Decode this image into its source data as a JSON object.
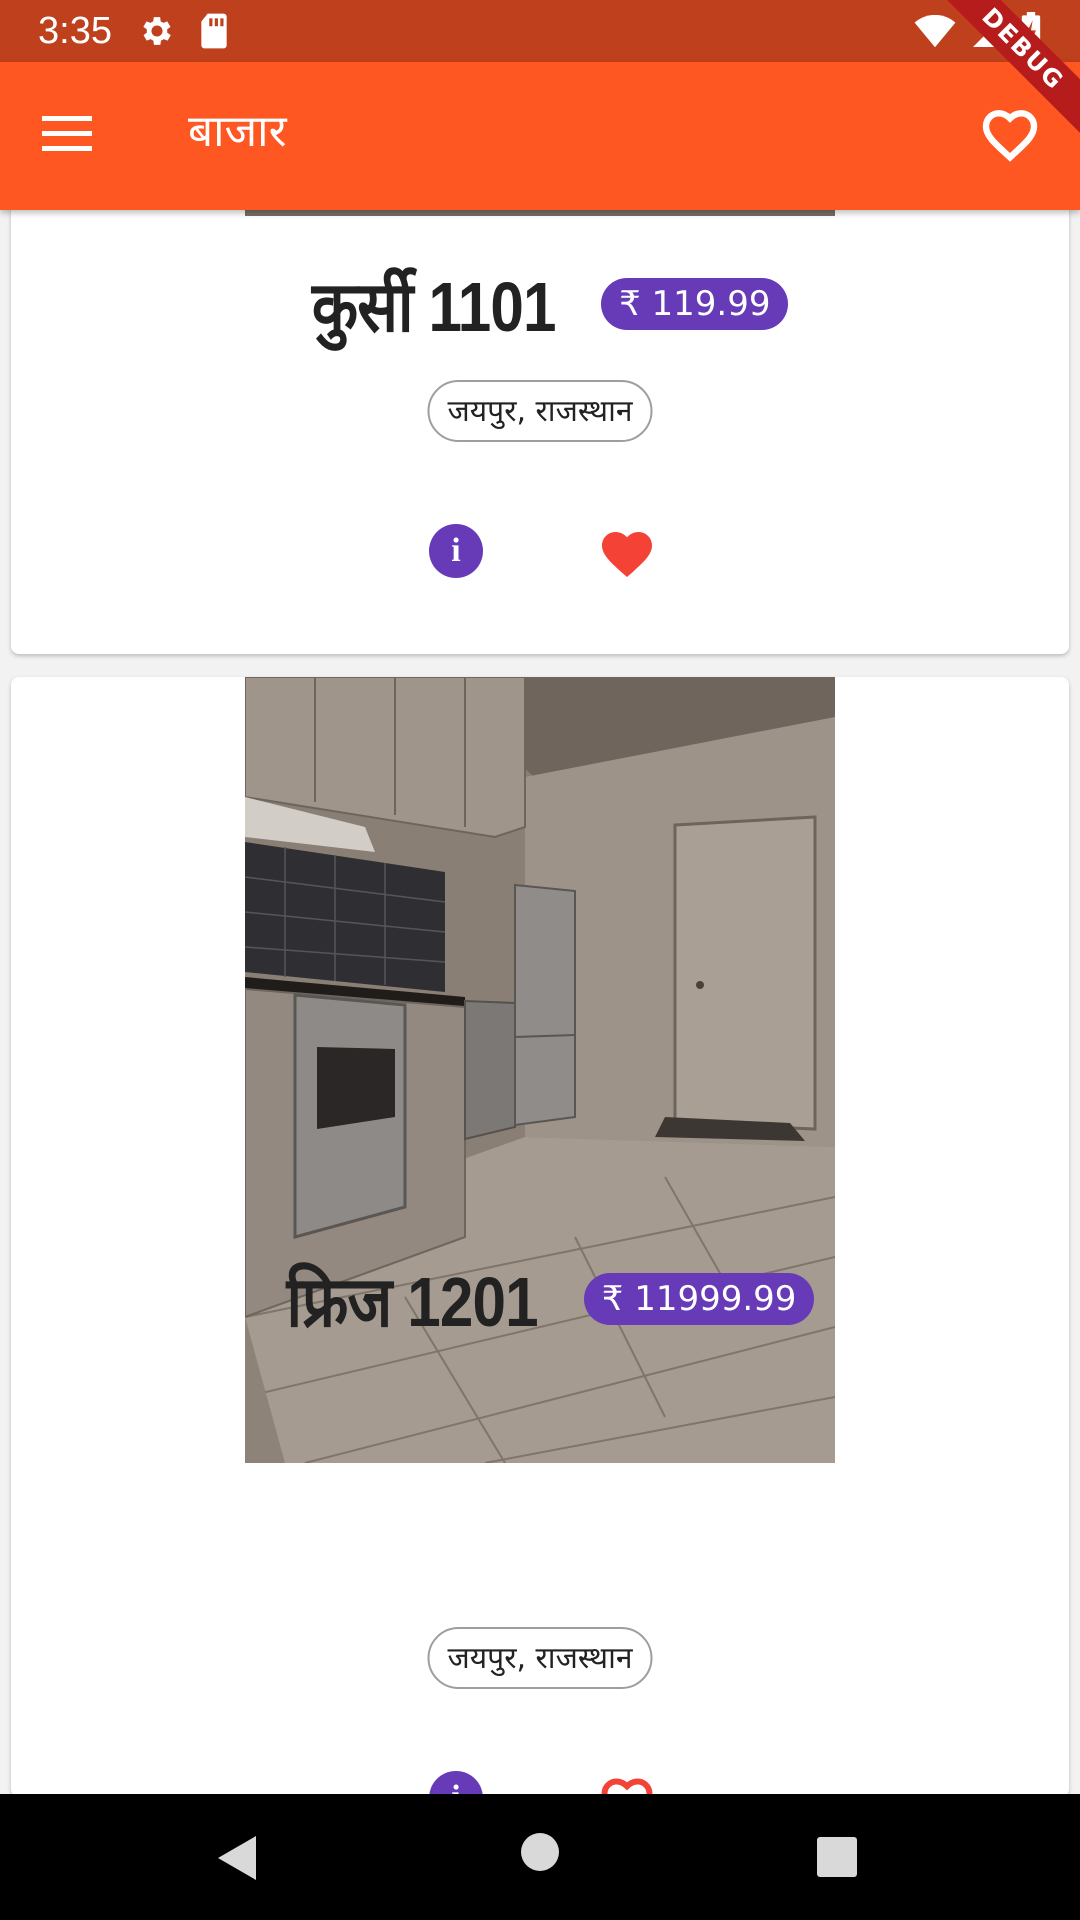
{
  "status_bar": {
    "time": "3:35",
    "icons": [
      "settings-icon",
      "sd-card-icon",
      "wifi-icon",
      "signal-icon",
      "battery-charging-icon"
    ]
  },
  "debug_banner": "DEBUG",
  "app_bar": {
    "title": "बाजार",
    "menu_icon": "menu-icon",
    "favorites_icon": "heart-outline-icon"
  },
  "products": [
    {
      "name": "कुर्सी 1101",
      "price": "₹ 119.99",
      "location": "जयपुर, राजस्थान",
      "favorite": true
    },
    {
      "name": "फ्रिज 1201",
      "price": "₹ 11999.99",
      "location": "जयपुर, राजस्थान",
      "favorite": false
    }
  ],
  "colors": {
    "status_bar": "#bf401c",
    "app_bar": "#ff5722",
    "accent": "#673ab7",
    "favorite": "#f44336",
    "background": "#f2f2f2"
  },
  "nav_bar": {
    "icons": [
      "back-icon",
      "home-icon",
      "recents-icon"
    ]
  }
}
